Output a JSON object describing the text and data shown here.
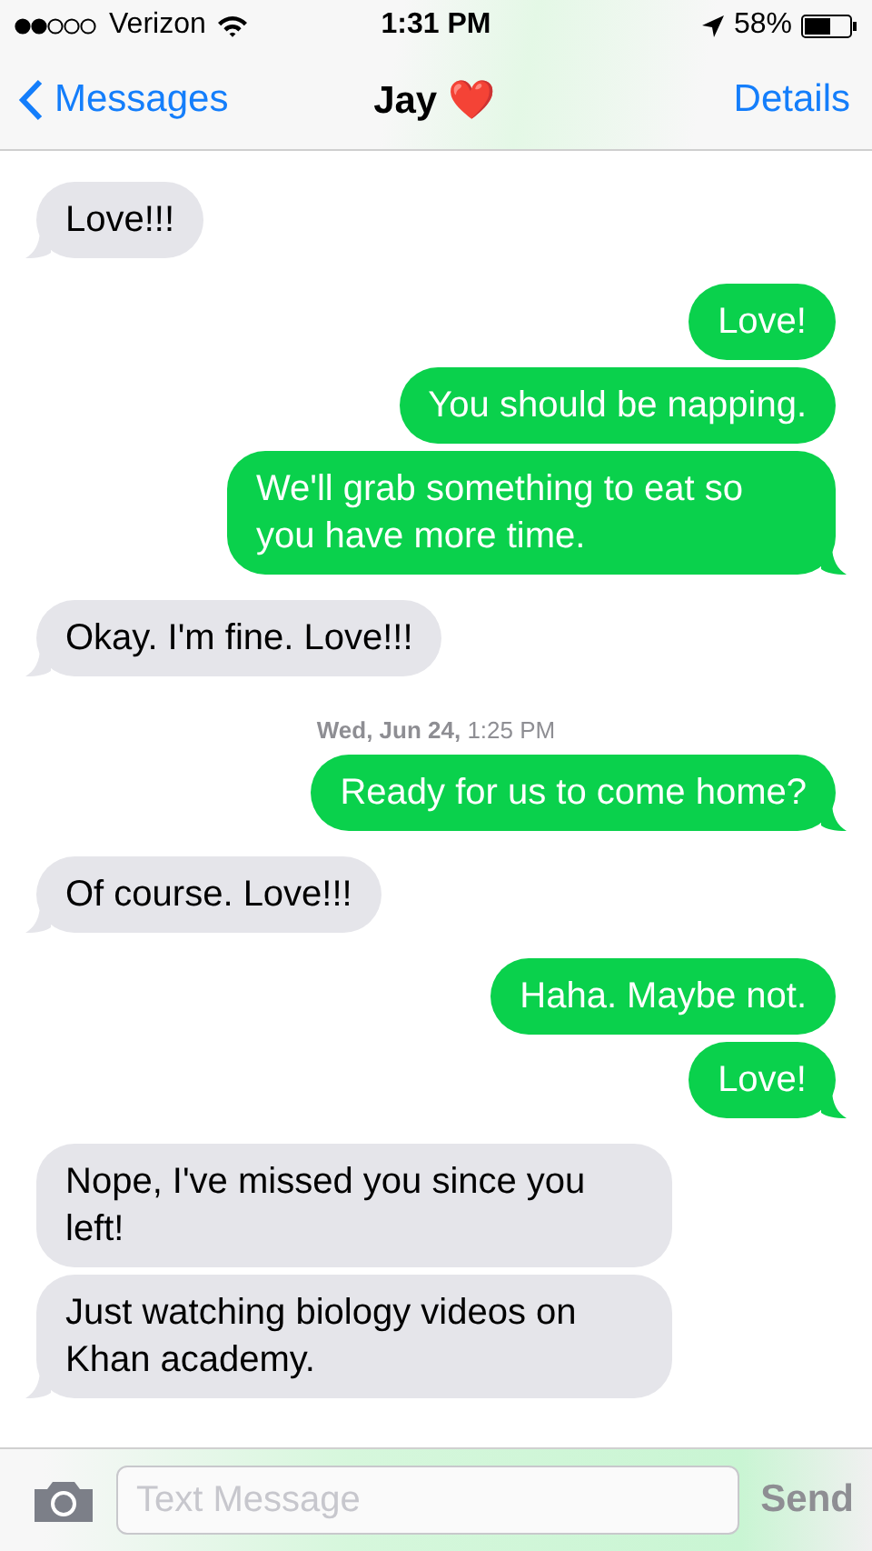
{
  "status_bar": {
    "carrier": "Verizon",
    "time": "1:31 PM",
    "battery": "58%"
  },
  "nav": {
    "back": "Messages",
    "title": "Jay ❤️",
    "action": "Details"
  },
  "messages": [
    {
      "kind": "received",
      "text": "Love!!!",
      "tail": true
    },
    {
      "kind": "sent",
      "text": "Love!",
      "tail": false
    },
    {
      "kind": "sent",
      "text": "You should be napping.",
      "tail": false
    },
    {
      "kind": "sent",
      "text": "We'll grab something to eat so you have more time.",
      "tail": true
    },
    {
      "kind": "received",
      "text": "Okay. I'm fine. Love!!!",
      "tail": true
    },
    {
      "kind": "timestamp",
      "text": "**Wed, Jun 24,** 1:25 PM"
    },
    {
      "kind": "sent",
      "text": "Ready for us to come home?",
      "tail": true
    },
    {
      "kind": "received",
      "text": "Of course. Love!!!",
      "tail": true
    },
    {
      "kind": "sent",
      "text": "Haha. Maybe not.",
      "tail": false
    },
    {
      "kind": "sent",
      "text": "Love!",
      "tail": true
    },
    {
      "kind": "received",
      "text": "Nope, I've missed you since you left!",
      "tail": false
    },
    {
      "kind": "received",
      "text": "Just watching biology videos on Khan academy.",
      "tail": true
    }
  ],
  "composer": {
    "placeholder": "Text Message",
    "send": "Send"
  }
}
